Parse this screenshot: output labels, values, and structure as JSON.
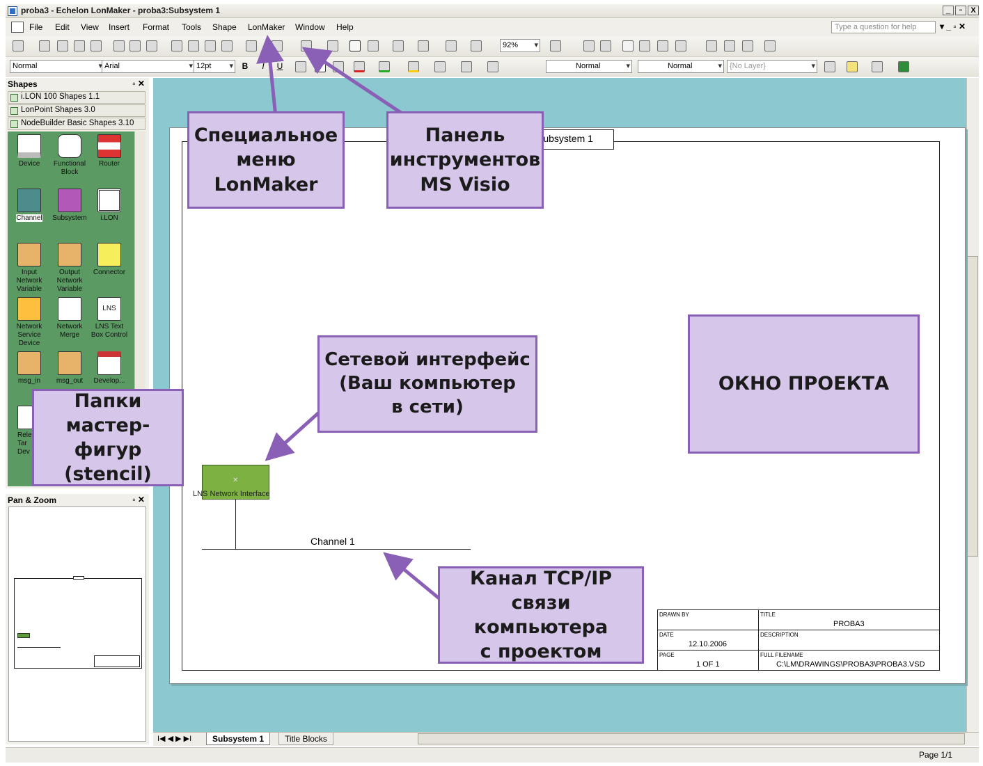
{
  "window": {
    "title": "proba3 - Echelon LonMaker - proba3:Subsystem 1",
    "buttons": [
      "_",
      "▫",
      "X"
    ]
  },
  "menu": {
    "items": [
      "File",
      "Edit",
      "View",
      "Insert",
      "Format",
      "Tools",
      "Shape",
      "LonMaker",
      "Window",
      "Help"
    ],
    "help_placeholder": "Type a question for help"
  },
  "toolbar": {
    "zoom": "92%",
    "style": "Normal",
    "font": "Arial",
    "size": "12pt",
    "line_style": "Normal",
    "fill_style": "Normal",
    "layer": "{No Layer}"
  },
  "shapes_pane": {
    "title": "Shapes",
    "stencils": [
      "i.LON 100 Shapes 1.1",
      "LonPoint Shapes 3.0",
      "NodeBuilder Basic Shapes 3.10"
    ],
    "shapes": [
      "Device",
      "Functional Block",
      "Router",
      "Channel",
      "Subsystem",
      "i.LON",
      "Input Network Variable",
      "Output Network Variable",
      "Connector",
      "Network Service Device",
      "Network Merge",
      "LNS Text Box Control",
      "msg_in",
      "msg_out",
      "Develop..."
    ],
    "partial_shape": [
      "Rele",
      "Tar",
      "Dev"
    ]
  },
  "pan_zoom": {
    "title": "Pan & Zoom"
  },
  "drawing": {
    "subsystem_label": "Subsystem 1",
    "network_interface_label": "LNS Network Interface",
    "channel_label": "Channel 1",
    "title_block": {
      "drawn_by_label": "DRAWN BY",
      "title_label": "TITLE",
      "title_value": "PROBA3",
      "date_label": "DATE",
      "date_value": "12.10.2006",
      "description_label": "DESCRIPTION",
      "page_label": "PAGE",
      "page_value": "1 OF 1",
      "filename_label": "FULL FILENAME",
      "filename_value": "C:\\LM\\DRAWINGS\\PROBA3\\PROBA3.VSD"
    }
  },
  "tabs": [
    "Subsystem 1",
    "Title Blocks"
  ],
  "status": {
    "page": "Page 1/1"
  },
  "callouts": {
    "lonmaker_menu": "Специальное\nменю\nLonMaker",
    "visio_toolbar": "Панель\nинструментов\nMS Visio",
    "network_interface": "Сетевой интерфейс\n(Ваш компьютер\nв сети)",
    "project_window": "ОКНО ПРОЕКТА",
    "stencil_folders": "Папки\nмастер-фигур\n(stencil)",
    "tcpip_channel": "Канал TCP/IP связи\nкомпьютера\nс проектом"
  },
  "colors": {
    "callout_fill": "#d6c7ea",
    "callout_border": "#8a5fb6",
    "canvas_bg": "#8cc8cf",
    "stencil_bg": "#5c9a64",
    "network_interface_fill": "#7db142"
  }
}
